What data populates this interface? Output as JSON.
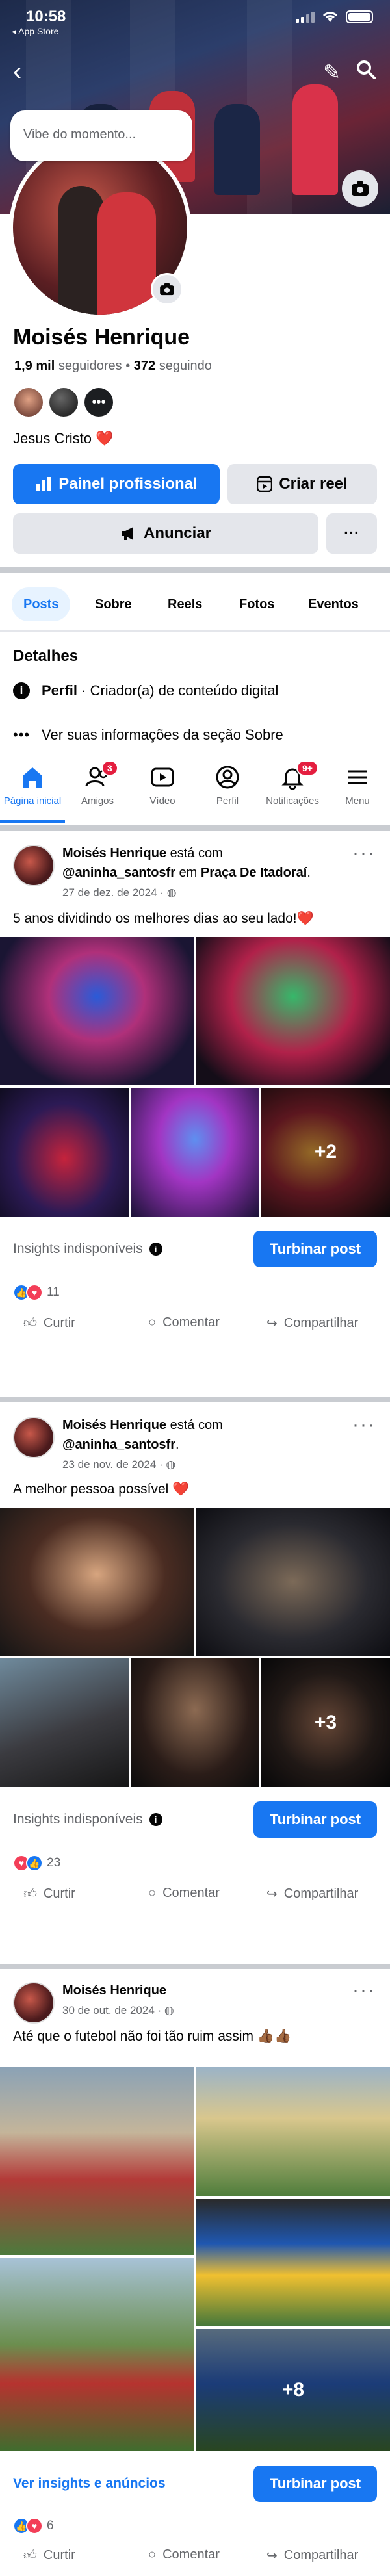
{
  "status_bar": {
    "time": "10:58",
    "back_app": "◂ App Store"
  },
  "header": {
    "status_bubble_placeholder": "Vibe do momento..."
  },
  "profile": {
    "name": "Moisés Henrique",
    "followers_count": "1,9 mil",
    "followers_label": "seguidores",
    "following_count": "372",
    "following_label": "seguindo",
    "bio": "Jesus Cristo",
    "bio_emoji": "❤️"
  },
  "buttons": {
    "professional": "Painel profissional",
    "create_reel": "Criar reel",
    "advertise": "Anunciar",
    "more": "···"
  },
  "tabs": [
    "Posts",
    "Sobre",
    "Reels",
    "Fotos",
    "Eventos"
  ],
  "details": {
    "title": "Detalhes",
    "profile_label": "Perfil",
    "profile_value": " · Criador(a) de conteúdo digital",
    "about_link": "Ver suas informações da seção Sobre"
  },
  "bottom_nav": [
    {
      "label": "Página inicial",
      "badge": ""
    },
    {
      "label": "Amigos",
      "badge": "3"
    },
    {
      "label": "Vídeo",
      "badge": ""
    },
    {
      "label": "Perfil",
      "badge": ""
    },
    {
      "label": "Notificações",
      "badge": "9+"
    },
    {
      "label": "Menu",
      "badge": ""
    }
  ],
  "posts": [
    {
      "author": "Moisés Henrique",
      "connector": " está com ",
      "tagged": "@aninha_santosfr",
      "location_prefix": " em ",
      "location": "Praça De Itadoraí",
      "location_suffix": ".",
      "date": "27 de dez. de 2024 · ",
      "text": "5 anos dividindo os melhores dias ao seu lado!❤️",
      "more_photos": "+2",
      "insights": "Insights indisponíveis",
      "boost": "Turbinar post",
      "reaction_count": "11",
      "actions": [
        "Curtir",
        "Comentar",
        "Compartilhar"
      ]
    },
    {
      "author": "Moisés Henrique",
      "connector": " está com ",
      "tagged": "@aninha_santosfr",
      "location_prefix": "",
      "location": "",
      "location_suffix": ".",
      "date": "23 de nov. de 2024 · ",
      "text": "A melhor pessoa possível ❤️",
      "more_photos": "+3",
      "insights": "Insights indisponíveis",
      "boost": "Turbinar post",
      "reaction_count": "23",
      "actions": [
        "Curtir",
        "Comentar",
        "Compartilhar"
      ]
    },
    {
      "author": "Moisés Henrique",
      "date": "30 de out. de 2024 · ",
      "text": "Até que o futebol não foi tão ruim assim 👍🏾👍🏾",
      "more_photos": "+8",
      "insights": "Ver insights e anúncios",
      "boost": "Turbinar post",
      "reaction_count": "6",
      "actions": [
        "Curtir",
        "Comentar",
        "Compartilhar"
      ]
    }
  ]
}
